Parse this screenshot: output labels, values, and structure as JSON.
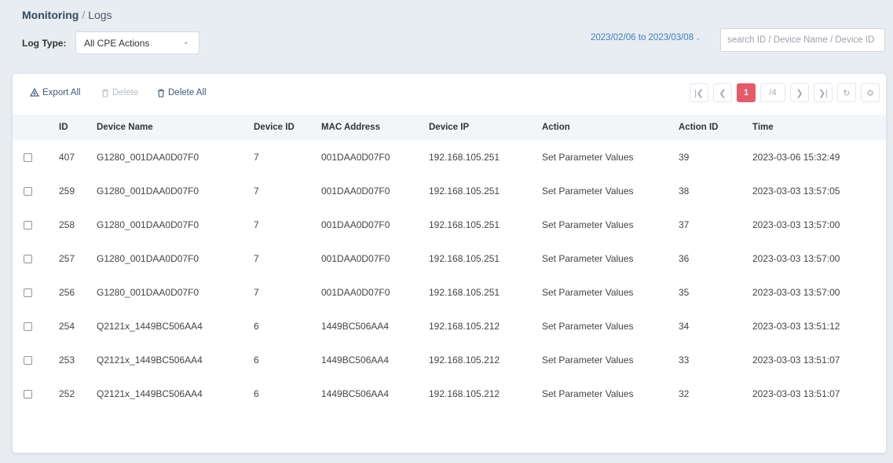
{
  "breadcrumb": {
    "section": "Monitoring",
    "separator": "/",
    "page": "Logs"
  },
  "filters": {
    "log_type_label": "Log Type:",
    "log_type_value": "All CPE Actions",
    "date_range": "2023/02/06 to 2023/03/08",
    "search_placeholder": "search ID / Device Name / Device ID"
  },
  "toolbar": {
    "export_all": "Export All",
    "delete": "Delete",
    "delete_all": "Delete All"
  },
  "pagination": {
    "current_page": "1",
    "total_pages": "/4"
  },
  "colors": {
    "accent": "#e65a68",
    "link": "#3c7fc0",
    "background": "#e8edf2"
  },
  "table": {
    "columns": [
      "ID",
      "Device Name",
      "Device ID",
      "MAC Address",
      "Device IP",
      "Action",
      "Action ID",
      "Time"
    ],
    "rows": [
      {
        "id": "407",
        "name": "G1280_001DAA0D07F0",
        "device_id": "7",
        "mac": "001DAA0D07F0",
        "ip": "192.168.105.251",
        "action": "Set Parameter Values",
        "action_id": "39",
        "time": "2023-03-06 15:32:49"
      },
      {
        "id": "259",
        "name": "G1280_001DAA0D07F0",
        "device_id": "7",
        "mac": "001DAA0D07F0",
        "ip": "192.168.105.251",
        "action": "Set Parameter Values",
        "action_id": "38",
        "time": "2023-03-03 13:57:05"
      },
      {
        "id": "258",
        "name": "G1280_001DAA0D07F0",
        "device_id": "7",
        "mac": "001DAA0D07F0",
        "ip": "192.168.105.251",
        "action": "Set Parameter Values",
        "action_id": "37",
        "time": "2023-03-03 13:57:00"
      },
      {
        "id": "257",
        "name": "G1280_001DAA0D07F0",
        "device_id": "7",
        "mac": "001DAA0D07F0",
        "ip": "192.168.105.251",
        "action": "Set Parameter Values",
        "action_id": "36",
        "time": "2023-03-03 13:57:00"
      },
      {
        "id": "256",
        "name": "G1280_001DAA0D07F0",
        "device_id": "7",
        "mac": "001DAA0D07F0",
        "ip": "192.168.105.251",
        "action": "Set Parameter Values",
        "action_id": "35",
        "time": "2023-03-03 13:57:00"
      },
      {
        "id": "254",
        "name": "Q2121x_1449BC506AA4",
        "device_id": "6",
        "mac": "1449BC506AA4",
        "ip": "192.168.105.212",
        "action": "Set Parameter Values",
        "action_id": "34",
        "time": "2023-03-03 13:51:12"
      },
      {
        "id": "253",
        "name": "Q2121x_1449BC506AA4",
        "device_id": "6",
        "mac": "1449BC506AA4",
        "ip": "192.168.105.212",
        "action": "Set Parameter Values",
        "action_id": "33",
        "time": "2023-03-03 13:51:07"
      },
      {
        "id": "252",
        "name": "Q2121x_1449BC506AA4",
        "device_id": "6",
        "mac": "1449BC506AA4",
        "ip": "192.168.105.212",
        "action": "Set Parameter Values",
        "action_id": "32",
        "time": "2023-03-03 13:51:07"
      }
    ]
  }
}
